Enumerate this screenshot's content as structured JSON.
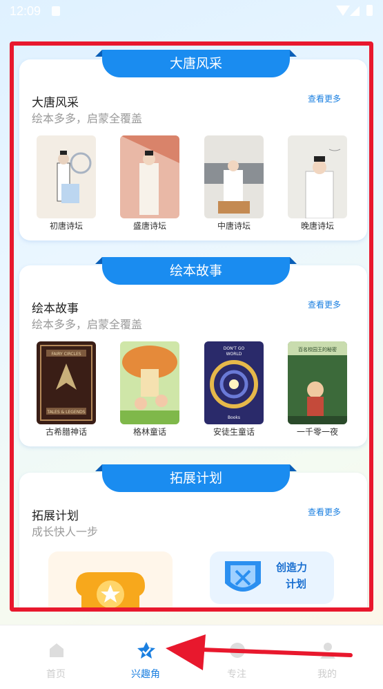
{
  "status_bar": {
    "time": "12:09"
  },
  "sections": [
    {
      "banner": "大唐风采",
      "title": "大唐风采",
      "subtitle": "绘本多多，启蒙全覆盖",
      "more": "查看更多",
      "books": [
        {
          "label": "初唐诗坛"
        },
        {
          "label": "盛唐诗坛"
        },
        {
          "label": "中唐诗坛"
        },
        {
          "label": "晚唐诗坛"
        }
      ]
    },
    {
      "banner": "绘本故事",
      "title": "绘本故事",
      "subtitle": "绘本多多，启蒙全覆盖",
      "more": "查看更多",
      "books": [
        {
          "label": "古希腊神话",
          "cover_text": [
            "FAIRY CIRCLES",
            "TALES & LEGENDS"
          ]
        },
        {
          "label": "格林童话"
        },
        {
          "label": "安徒生童话",
          "cover_text": [
            "DON'T GO",
            "WORLD",
            "Books"
          ]
        },
        {
          "label": "一千零一夜",
          "cover_text": "百名校园王的秘密"
        }
      ]
    },
    {
      "banner": "拓展计划",
      "title": "拓展计划",
      "subtitle": "成长快人一步",
      "more": "查看更多",
      "tiles": [
        {
          "label": ""
        },
        {
          "label_line1": "创造力",
          "label_line2": "计划"
        }
      ]
    }
  ],
  "nav": [
    {
      "label": "首页",
      "icon": "home-icon",
      "active": false
    },
    {
      "label": "兴趣角",
      "icon": "star-badge-icon",
      "active": true
    },
    {
      "label": "专注",
      "icon": "focus-icon",
      "active": false
    },
    {
      "label": "我的",
      "icon": "profile-icon",
      "active": false
    }
  ],
  "colors": {
    "accent": "#1a8cf0",
    "highlight": "#e8182d",
    "arrow": "#e8182d"
  }
}
